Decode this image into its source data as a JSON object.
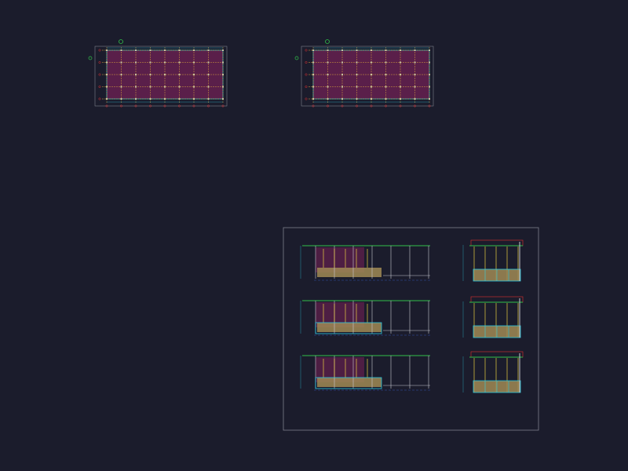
{
  "colors": {
    "background": "#1b1c2c",
    "sheet_frame": "#7d7f8c",
    "plan_fill": "#5a1f4a",
    "grid_line": "#d6a23a",
    "grid_axis": "#c23b3b",
    "dimension": "#2fb7c9",
    "section_line": "#c8c8d0",
    "roof_green": "#30c04a",
    "column_yellow": "#e8d040",
    "floor_tan": "#a08a55",
    "water_cyan": "#28c8e0",
    "marker_red": "#e03030"
  },
  "drawing": {
    "floor_plans": [
      {
        "name": "floor-plan-1"
      },
      {
        "name": "floor-plan-2"
      }
    ],
    "section_sheet": {
      "long_sections": 3,
      "short_sections": 3
    }
  }
}
